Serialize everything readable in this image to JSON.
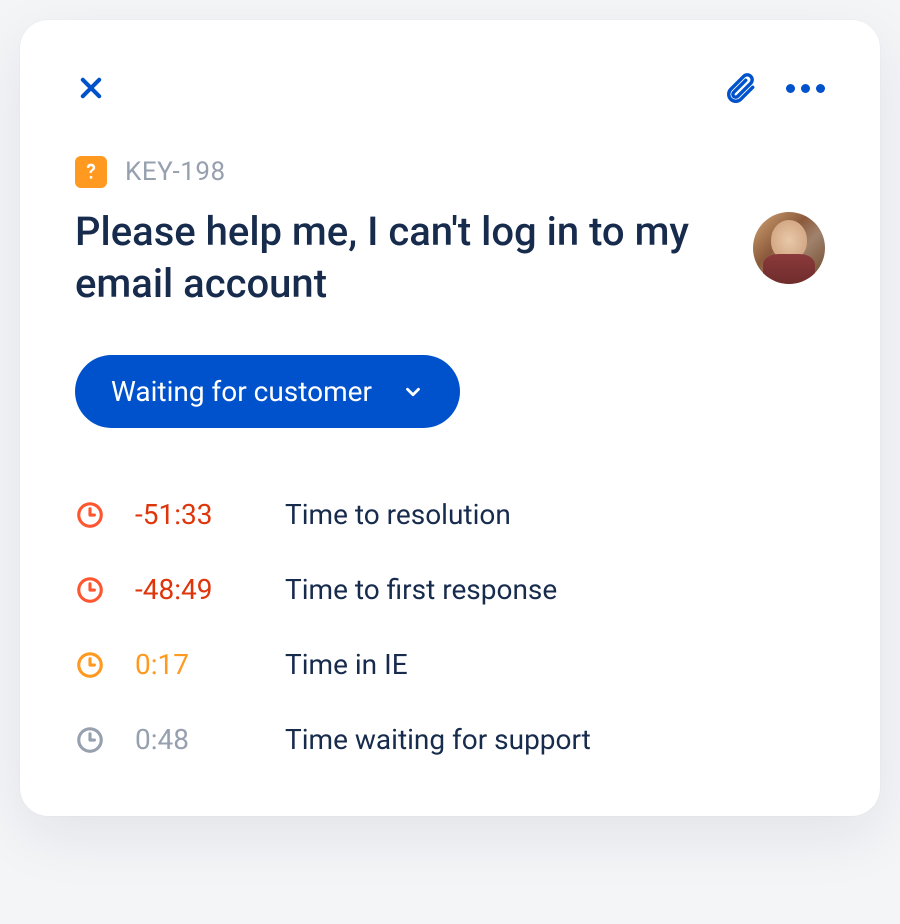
{
  "issue": {
    "key": "KEY-198",
    "title": "Please help me, I can't log in to my email account",
    "status_label": "Waiting for customer"
  },
  "sla": [
    {
      "time": "-51:33",
      "label": "Time to resolution",
      "icon_color": "red",
      "time_color": "red"
    },
    {
      "time": "-48:49",
      "label": "Time to first response",
      "icon_color": "red",
      "time_color": "red"
    },
    {
      "time": "0:17",
      "label": "Time in IE",
      "icon_color": "orange",
      "time_color": "orange"
    },
    {
      "time": "0:48",
      "label": "Time waiting for support",
      "icon_color": "gray",
      "time_color": "gray"
    }
  ]
}
